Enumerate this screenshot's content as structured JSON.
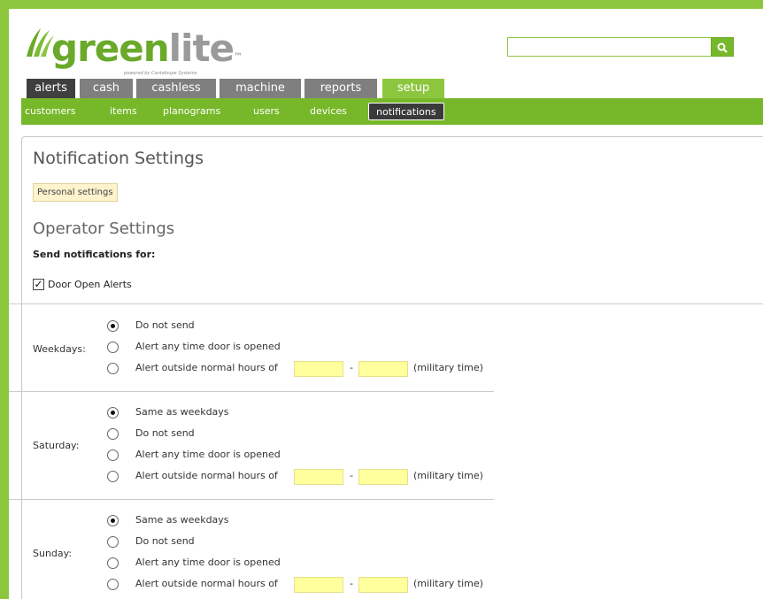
{
  "brand": {
    "name_green": "green",
    "name_gray": "lite",
    "trademark": "™",
    "powered_by": "powered by Cantaloupe Systems",
    "accent_color": "#8cc63f"
  },
  "search": {
    "placeholder": "",
    "button_icon": "search-icon"
  },
  "tabs": [
    {
      "label": "alerts"
    },
    {
      "label": "cash"
    },
    {
      "label": "cashless"
    },
    {
      "label": "machine"
    },
    {
      "label": "reports"
    },
    {
      "label": "setup",
      "active": true
    }
  ],
  "subnav": [
    {
      "label": "customers"
    },
    {
      "label": "items"
    },
    {
      "label": "planograms"
    },
    {
      "label": "users"
    },
    {
      "label": "devices"
    },
    {
      "label": "notifications",
      "active": true
    }
  ],
  "page": {
    "title": "Notification Settings",
    "personal_button": "Personal settings",
    "section_title": "Operator Settings",
    "send_for": "Send notifications for:",
    "door_open": {
      "label": "Door Open Alerts",
      "checked": true
    }
  },
  "weekdays": {
    "label": "Weekdays:",
    "options": [
      "Do not send",
      "Alert any time door is opened",
      "Alert outside normal hours of"
    ],
    "selected": 0,
    "dash": "-",
    "suffix": "(military time)"
  },
  "saturday": {
    "label": "Saturday:",
    "options": [
      "Same as weekdays",
      "Do not send",
      "Alert any time door is opened",
      "Alert outside normal hours of"
    ],
    "selected": 0,
    "dash": "-",
    "suffix": "(military time)"
  },
  "sunday": {
    "label": "Sunday:",
    "options": [
      "Same as weekdays",
      "Do not send",
      "Alert any time door is opened",
      "Alert outside normal hours of"
    ],
    "selected": 0,
    "dash": "-",
    "suffix": "(military time)"
  }
}
